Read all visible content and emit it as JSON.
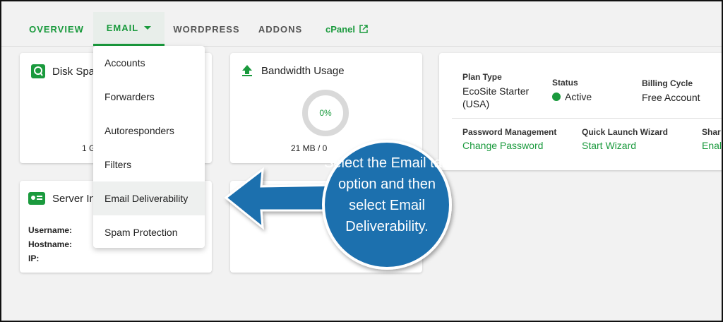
{
  "nav": {
    "tabs": [
      {
        "label": "OVERVIEW"
      },
      {
        "label": "EMAIL"
      },
      {
        "label": "WORDPRESS"
      },
      {
        "label": "ADDONS"
      },
      {
        "label": "cPanel"
      }
    ]
  },
  "dropdown": {
    "items": [
      "Accounts",
      "Forwarders",
      "Autoresponders",
      "Filters",
      "Email Deliverability",
      "Spam Protection"
    ]
  },
  "disk_card": {
    "title": "Disk Spa",
    "usage_partial": "1 G"
  },
  "bandwidth_card": {
    "title": "Bandwidth Usage",
    "percent": "0%",
    "usage": "21 MB / 0"
  },
  "server_card": {
    "title": "Server In",
    "username_label": "Username:",
    "hostname_label": "Hostname:",
    "ip_label": "IP:"
  },
  "plan_card": {
    "plan_type_label": "Plan Type",
    "plan_type_value": "EcoSite Starter (USA)",
    "status_label": "Status",
    "status_value": "Active",
    "billing_label": "Billing Cycle",
    "billing_value": "Free Account",
    "password_label": "Password Management",
    "password_link": "Change Password",
    "wizard_label": "Quick Launch Wizard",
    "wizard_link": "Start Wizard",
    "share_label": "Shar",
    "share_link": "Enal"
  },
  "callout": {
    "text": "Select the Email tab option and then select Email Deliverability."
  },
  "colors": {
    "accent": "#1a9a3d",
    "callout": "#1f6fae",
    "background": "#f2f2f2"
  }
}
